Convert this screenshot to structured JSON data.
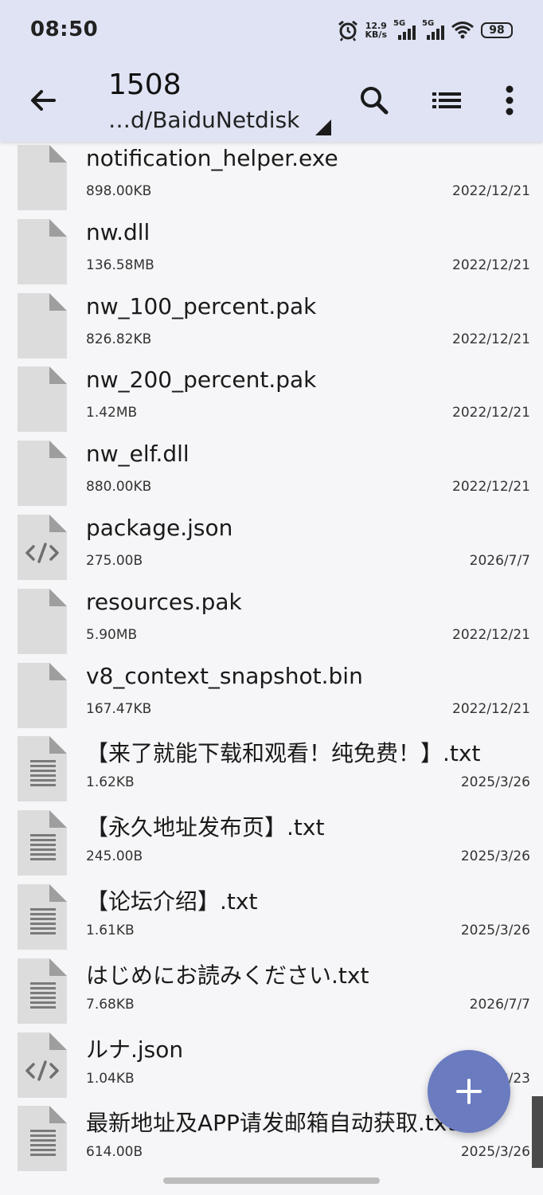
{
  "status_bar": {
    "time": "08:50",
    "net_speed_value": "12.9",
    "net_speed_unit": "KB/s",
    "sim1_label": "5G",
    "sim2_label": "5G",
    "battery": "98"
  },
  "header": {
    "title": "1508",
    "path": "…d/BaiduNetdisk"
  },
  "icons": {
    "back": "arrow-left-icon",
    "search": "search-icon",
    "view": "list-view-icon",
    "more": "more-vert-icon",
    "fab": "plus-icon"
  },
  "files": [
    {
      "name": "notification_helper.exe",
      "size": "898.00KB",
      "date": "2022/12/21",
      "icon": "generic"
    },
    {
      "name": "nw.dll",
      "size": "136.58MB",
      "date": "2022/12/21",
      "icon": "generic"
    },
    {
      "name": "nw_100_percent.pak",
      "size": "826.82KB",
      "date": "2022/12/21",
      "icon": "generic"
    },
    {
      "name": "nw_200_percent.pak",
      "size": "1.42MB",
      "date": "2022/12/21",
      "icon": "generic"
    },
    {
      "name": "nw_elf.dll",
      "size": "880.00KB",
      "date": "2022/12/21",
      "icon": "generic"
    },
    {
      "name": "package.json",
      "size": "275.00B",
      "date": "2026/7/7",
      "icon": "code"
    },
    {
      "name": "resources.pak",
      "size": "5.90MB",
      "date": "2022/12/21",
      "icon": "generic"
    },
    {
      "name": "v8_context_snapshot.bin",
      "size": "167.47KB",
      "date": "2022/12/21",
      "icon": "generic"
    },
    {
      "name": "【来了就能下载和观看！纯免费！】.txt",
      "size": "1.62KB",
      "date": "2025/3/26",
      "icon": "text"
    },
    {
      "name": "【永久地址发布页】.txt",
      "size": "245.00B",
      "date": "2025/3/26",
      "icon": "text"
    },
    {
      "name": "【论坛介绍】.txt",
      "size": "1.61KB",
      "date": "2025/3/26",
      "icon": "text"
    },
    {
      "name": "はじめにお読みください.txt",
      "size": "7.68KB",
      "date": "2026/7/7",
      "icon": "text"
    },
    {
      "name": "ルナ.json",
      "size": "1.04KB",
      "date": "2025/3/23",
      "icon": "code"
    },
    {
      "name": "最新地址及APP请发邮箱自动获取.txt",
      "size": "614.00B",
      "date": "2025/3/26",
      "icon": "text"
    }
  ],
  "colors": {
    "appbar": "#dfe3f3",
    "background": "#f6f6f8",
    "fab": "#6a7bc0",
    "file_icon": "#dcdcdc"
  }
}
